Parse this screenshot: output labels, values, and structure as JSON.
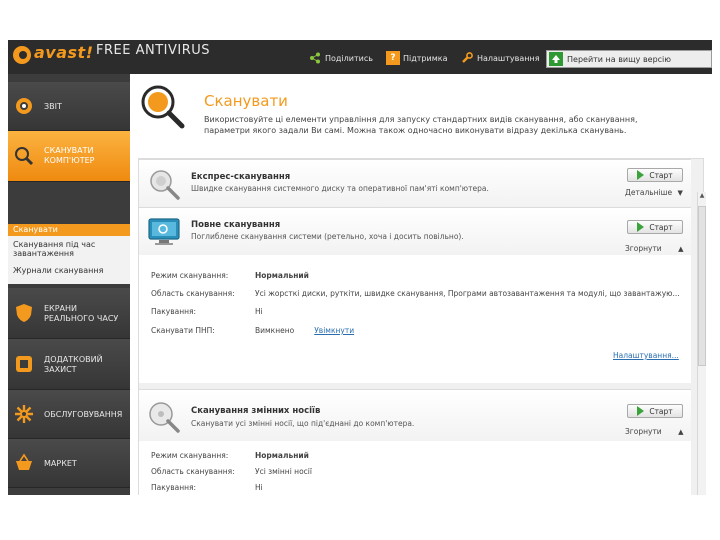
{
  "app": {
    "logo_text": "avast!",
    "logo_sub": "FREE ANTIVIRUS"
  },
  "topnav": {
    "share": "Поділитись",
    "support": "Підтримка",
    "settings": "Налаштування",
    "upgrade": "Перейти на вищу версію"
  },
  "sidebar": {
    "items": [
      {
        "label": "Звіт",
        "icon": "eye-icon"
      },
      {
        "label": "Сканувати комп'ютер",
        "icon": "magnifier-icon"
      },
      {
        "label": "Екрани реального часу",
        "icon": "shield-icon"
      },
      {
        "label": "Додатковий захист",
        "icon": "box-icon"
      },
      {
        "label": "Обслуговування",
        "icon": "gear-icon"
      },
      {
        "label": "Маркет",
        "icon": "basket-icon"
      }
    ],
    "submenu": [
      "Сканувати",
      "Сканування під час завантаження",
      "Журнали сканування"
    ]
  },
  "main": {
    "title": "Сканувати",
    "description": "Використовуйте ці елементи управління для запуску стандартних видів сканування, або сканування, параметри якого задали Ви самі. Можна також одночасно виконувати відразу декілька сканувань.",
    "start_label": "Старт",
    "cards": [
      {
        "title": "Експрес-сканування",
        "desc": "Швидке сканування системного диску та оперативної пам'яті комп'ютера.",
        "toggle": "Детальніше",
        "icon": "express-scan-icon"
      },
      {
        "title": "Повне сканування",
        "desc": "Поглиблене сканування системи (ретельно, хоча і досить повільно).",
        "toggle": "Згорнути",
        "icon": "monitor-scan-icon",
        "rows": [
          {
            "key": "Режим сканування:",
            "value": "Нормальний"
          },
          {
            "key": "Область сканування:",
            "value": "Усі жорсткі диски, руткіти, швидке сканування, Програми автозавантаження та модулі, що завантажую..."
          },
          {
            "key": "Пакування:",
            "value": "Ні"
          },
          {
            "key": "Сканувати ПНП:",
            "value": "Вимкнено",
            "link": "Увімкнути"
          }
        ],
        "settings_link": "Налаштування..."
      },
      {
        "title": "Сканування змінних носіїв",
        "desc": "Сканувати усі змінні носії, що під'єднані до комп'ютера.",
        "toggle": "Згорнути",
        "icon": "removable-scan-icon",
        "rows": [
          {
            "key": "Режим сканування:",
            "value": "Нормальний"
          },
          {
            "key": "Область сканування:",
            "value": "Усі змінні носії"
          },
          {
            "key": "Пакування:",
            "value": "Ні"
          }
        ]
      }
    ]
  },
  "colors": {
    "accent": "#f39a1e",
    "header_bg": "#2c2c2c",
    "sidebar_bg": "#3c3c3c",
    "start_green": "#3ca33c",
    "link": "#2a6db0"
  }
}
